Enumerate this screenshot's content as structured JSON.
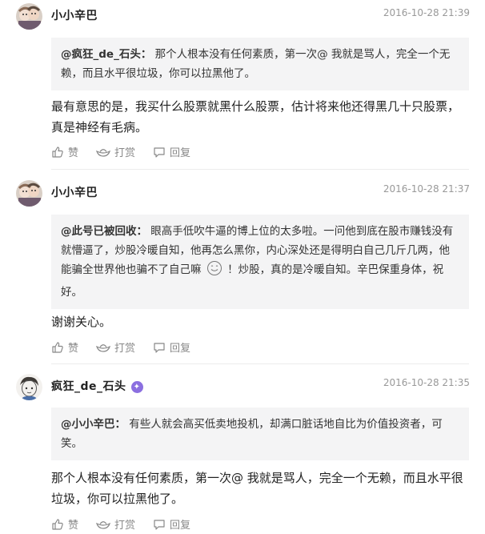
{
  "comments": [
    {
      "author": "小小辛巴",
      "time": "2016-10-28 21:39",
      "quote_name": "@疯狂_de_石头：",
      "quote_text": "那个人根本没有任何素质，第一次@ 我就是骂人，完全一个无赖，而且水平很垃圾，你可以拉黑他了。",
      "body": "最有意思的是，我买什么股票就黑什么股票，估计将来他还得黑几十只股票，真是神经有毛病。",
      "like_label": "赞",
      "reward_label": "打赏",
      "reply_label": "回复",
      "avatar_icon": "avatar-cartoon-pair"
    },
    {
      "author": "小小辛巴",
      "time": "2016-10-28 21:37",
      "quote_name": "@此号已被回收：",
      "quote_text_a": "眼高手低吹牛逼的博上位的太多啦。一问他到底在股市赚钱没有就懵逼了，炒股冷暖自知，他再怎么黑你，内心深处还是得明白自己几斤几两，他能骗全世界他也骗不了自己嘛",
      "quote_text_b": "！炒股，真的是冷暖自知。辛巴保重身体，祝好。",
      "emoji_icon": "smile-emoji-icon",
      "body": "谢谢关心。",
      "like_label": "赞",
      "reward_label": "打赏",
      "reply_label": "回复",
      "avatar_icon": "avatar-cartoon-pair"
    },
    {
      "author": "疯狂_de_石头",
      "verified_icon": "verified-badge-icon",
      "time": "2016-10-28 21:35",
      "quote_name": "@小小辛巴：",
      "quote_text": "有些人就会高买低卖地投机，却满口脏话地自比为价值投资者，可笑。",
      "body": "那个人根本没有任何素质，第一次@ 我就是骂人，完全一个无赖，而且水平很垃圾，你可以拉黑他了。",
      "like_label": "赞",
      "reward_label": "打赏",
      "reply_label": "回复",
      "avatar_icon": "avatar-sketch-face"
    }
  ],
  "colors": {
    "quote_bg": "#f4f4f5",
    "meta_text": "#999999",
    "action_text": "#888888",
    "badge": "#8b6fe0"
  }
}
